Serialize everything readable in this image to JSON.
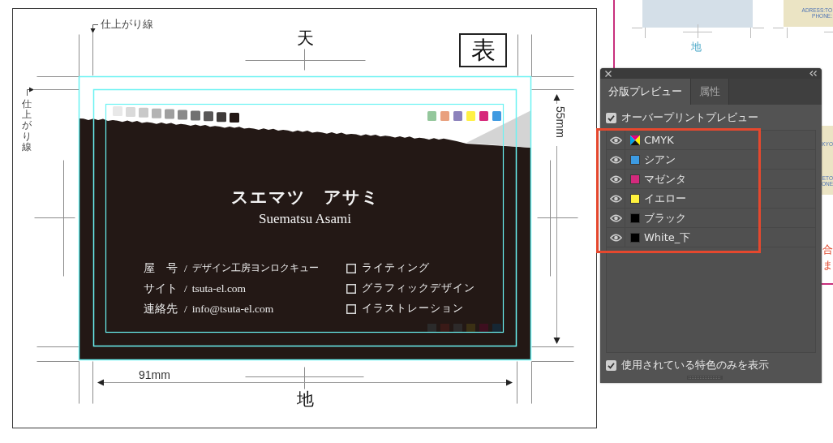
{
  "artboard": {
    "trim_label_top": "仕上がり線",
    "trim_label_side": "仕上がり線",
    "top_label": "天",
    "side_badge": "表",
    "height_dimension": "55mm",
    "width_dimension": "91mm",
    "bottom_label": "地",
    "card": {
      "gray_swatches": [
        {
          "color": "#e8e8e8"
        },
        {
          "color": "#dadada"
        },
        {
          "color": "#c9c9c9"
        },
        {
          "color": "#b4b4b4"
        },
        {
          "color": "#9f9f9f"
        },
        {
          "color": "#898989"
        },
        {
          "color": "#717171"
        },
        {
          "color": "#595757"
        },
        {
          "color": "#3e3a39"
        },
        {
          "color": "#231815"
        }
      ],
      "color_swatches": [
        {
          "color": "#94c79c"
        },
        {
          "color": "#e9a07e"
        },
        {
          "color": "#8c82bc"
        },
        {
          "color": "#fff145"
        },
        {
          "color": "#d6287b"
        },
        {
          "color": "#3f9ae1"
        }
      ],
      "name_kana": "スエマツ　アサミ",
      "name_roman": "Suematsu Asami",
      "details": [
        {
          "label": "屋　号",
          "separator": "/",
          "value": "デザイン工房ヨンロクキュー"
        },
        {
          "label": "サイト",
          "separator": "/",
          "value": "tsuta-el.com"
        },
        {
          "label": "連絡先",
          "separator": "/",
          "value": "info@tsuta-el.com"
        }
      ],
      "services": [
        {
          "label": "ライティング",
          "checked": false
        },
        {
          "label": "グラフィックデザイン",
          "checked": false
        },
        {
          "label": "イラストレーション",
          "checked": false
        }
      ],
      "faint_swatches": [
        {
          "color": "#2b2b2b"
        },
        {
          "color": "#3a1a17"
        },
        {
          "color": "#2d2a2a"
        },
        {
          "color": "#3b3014"
        },
        {
          "color": "#3d0f1f"
        },
        {
          "color": "#162734"
        }
      ]
    }
  },
  "background_pages": {
    "page_label": "地",
    "address_lines": [
      "ADRESS:TO",
      "PHONE:"
    ],
    "edge_lines": [
      "KYO",
      "ETO",
      "ONE"
    ],
    "note_lines": [
      "合",
      "ま"
    ]
  },
  "panel": {
    "tabs": [
      {
        "label": "分版プレビュー",
        "selected": true
      },
      {
        "label": "属性",
        "selected": false
      }
    ],
    "overprint_preview": {
      "label": "オーバープリントプレビュー",
      "checked": true
    },
    "separations": [
      {
        "name": "CMYK",
        "kind": "process",
        "visible": true
      },
      {
        "name": "シアン",
        "kind": "ink",
        "color": "#3d9be2",
        "visible": true
      },
      {
        "name": "マゼンタ",
        "kind": "ink",
        "color": "#d42a7d",
        "visible": true
      },
      {
        "name": "イエロー",
        "kind": "ink",
        "color": "#fff23d",
        "visible": true
      },
      {
        "name": "ブラック",
        "kind": "ink",
        "color": "#000000",
        "visible": true
      },
      {
        "name": "White_下",
        "kind": "ink",
        "color": "#000000",
        "visible": true
      }
    ],
    "spot_only": {
      "label": "使用されている特色のみを表示",
      "checked": true
    }
  }
}
